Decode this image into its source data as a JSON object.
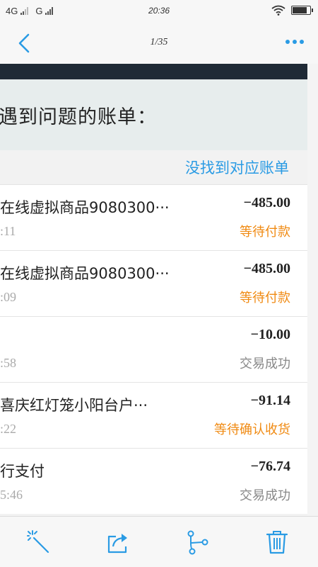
{
  "status_bar": {
    "network_1": "4G",
    "network_2": "G",
    "time": "20:36"
  },
  "nav": {
    "title": "1/35",
    "icons": [
      "back-arrow-icon",
      "more-dots-icon"
    ]
  },
  "header": {
    "text": "遇到问题的账单："
  },
  "not_found_link": "没找到对应账单",
  "bills": [
    {
      "name": "在线虚拟商品9080300···",
      "time": ":11",
      "amount": "−485.00",
      "status": "等待付款",
      "status_type": "pending"
    },
    {
      "name": "在线虚拟商品9080300···",
      "time": ":09",
      "amount": "−485.00",
      "status": "等待付款",
      "status_type": "pending"
    },
    {
      "name": "",
      "time": ":58",
      "amount": "−10.00",
      "status": "交易成功",
      "status_type": "done"
    },
    {
      "name": "喜庆红灯笼小阳台户···",
      "time": ":22",
      "amount": "−91.14",
      "status": "等待确认收货",
      "status_type": "pending"
    },
    {
      "name": "行支付",
      "time": "5:46",
      "amount": "−76.74",
      "status": "交易成功",
      "status_type": "done"
    }
  ],
  "toolbar": {
    "icons": [
      "magic-wand-icon",
      "share-icon",
      "branch-icon",
      "trash-icon"
    ]
  },
  "colors": {
    "accent": "#2a9be4",
    "pending": "#f08a12",
    "done": "#888888",
    "dark_strip": "#1f2a36"
  }
}
